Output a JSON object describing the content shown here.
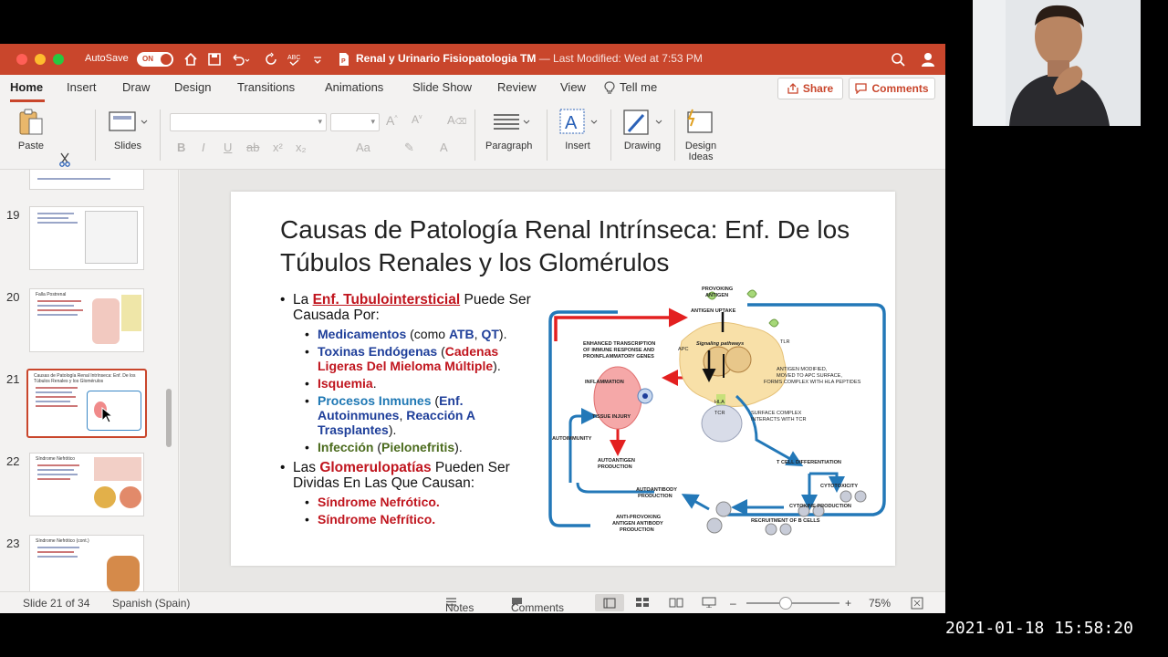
{
  "window": {
    "autosave_label": "AutoSave",
    "autosave_state": "ON",
    "doc_title": "Renal y Urinario Fisiopatologia TM",
    "last_modified": "— Last Modified: Wed at 7:53 PM"
  },
  "tabs": [
    {
      "label": "Home",
      "active": true
    },
    {
      "label": "Insert"
    },
    {
      "label": "Draw"
    },
    {
      "label": "Design"
    },
    {
      "label": "Transitions"
    },
    {
      "label": "Animations"
    },
    {
      "label": "Slide Show"
    },
    {
      "label": "Review"
    },
    {
      "label": "View"
    }
  ],
  "tell_me": "Tell me",
  "share_label": "Share",
  "comments_label": "Comments",
  "toolbar": {
    "paste": "Paste",
    "slides": "Slides",
    "paragraph": "Paragraph",
    "insert": "Insert",
    "drawing": "Drawing",
    "design_ideas": "Design\nIdeas",
    "format_buttons": [
      "B",
      "I",
      "U",
      "ab",
      "x²",
      "x₂",
      "Aa",
      "A"
    ]
  },
  "sidebar": {
    "thumbs": [
      {
        "num": "19",
        "title": ""
      },
      {
        "num": "20",
        "title": "Falla Postrenal"
      },
      {
        "num": "21",
        "title": "Causas de Patología Renal Intrínseca: Enf. De los Túbulos Renales y los Glomérulos",
        "selected": true
      },
      {
        "num": "22",
        "title": "Síndrome Nefrótico"
      },
      {
        "num": "23",
        "title": "Síndrome Nefrótico (cont.)"
      }
    ]
  },
  "slide": {
    "title": "Causas de Patología Renal Intrínseca: Enf. De los Túbulos Renales y los Glomérulos",
    "b1_pre": "La ",
    "b1_key": "Enf. Tubulointersticial",
    "b1_post": " Puede Ser Causada Por:",
    "s1_key": "Medicamentos",
    "s1_mid": " (como ",
    "s1_a": "ATB",
    "s1_comma": ", ",
    "s1_b": "QT",
    "s1_end": ").",
    "s2_key": "Toxinas Endógenas",
    "s2_open": " (",
    "s2_red": "Cadenas Ligeras Del Mieloma Múltiple",
    "s2_end": ").",
    "s3_key": "Isquemia",
    "s3_end": ".",
    "s4_key": "Procesos Inmunes",
    "s4_open": " (",
    "s4_a": "Enf. Autoinmunes",
    "s4_comma": ", ",
    "s4_b": "Reacción A Trasplantes",
    "s4_end": ").",
    "s5_key": "Infección",
    "s5_open": " (",
    "s5_b": "Pielonefritis",
    "s5_end": ").",
    "b2_pre": "Las ",
    "b2_key": "Glomerulopatías",
    "b2_post": " Pueden Ser Dividas En Las Que Causan:",
    "g1": "Síndrome Nefrótico.",
    "g2": "Síndrome Nefrítico."
  },
  "diagram": {
    "provoking": "PROVOKING\nANTIGEN",
    "uptake": "ANTIGEN UPTAKE",
    "signaling": "Signaling pathways",
    "tlr": "TLR",
    "apc": "APC",
    "enhanced": "ENHANCED TRANSCRIPTION\nOF IMMUNE RESPONSE AND\nPROINFLAMMATORY GENES",
    "inflammation": "INFLAMMATION",
    "tissue_injury": "TISSUE INJURY",
    "autoimmunity": "AUTOIMMUNITY",
    "autoantigen": "AUTOANTIGEN\nPRODUCTION",
    "modified": "ANTIGEN MODIFIED,\nMOVED TO APC SURFACE,\nFORMS COMPLEX WITH HLA PEPTIDES",
    "hla": "HLA",
    "tcr": "TCR",
    "surface": "SURFACE COMPLEX\nINTERACTS WITH TCR",
    "tcell": "T CELL DIFFERENTIATION",
    "cytotoxicity": "CYTOTOXICITY",
    "cytokine": "CYTOKINE PRODUCTION",
    "autoantibody": "AUTOANTIBODY\nPRODUCTION",
    "anti": "ANTI-PROVOKING\nANTIGEN ANTIBODY\nPRODUCTION",
    "recruitment": "RECRUITMENT OF B CELLS"
  },
  "status": {
    "slide": "Slide 21 of 34",
    "lang": "Spanish (Spain)",
    "notes": "Notes",
    "comments": "Comments",
    "zoom": "75%",
    "zoom_value": 0.42
  },
  "timestamp": "2021-01-18 15:58:20",
  "colors": {
    "titlebar": "#c9462c",
    "accent": "#c9462c",
    "navy": "#1f3f9a",
    "red": "#c0151e"
  }
}
